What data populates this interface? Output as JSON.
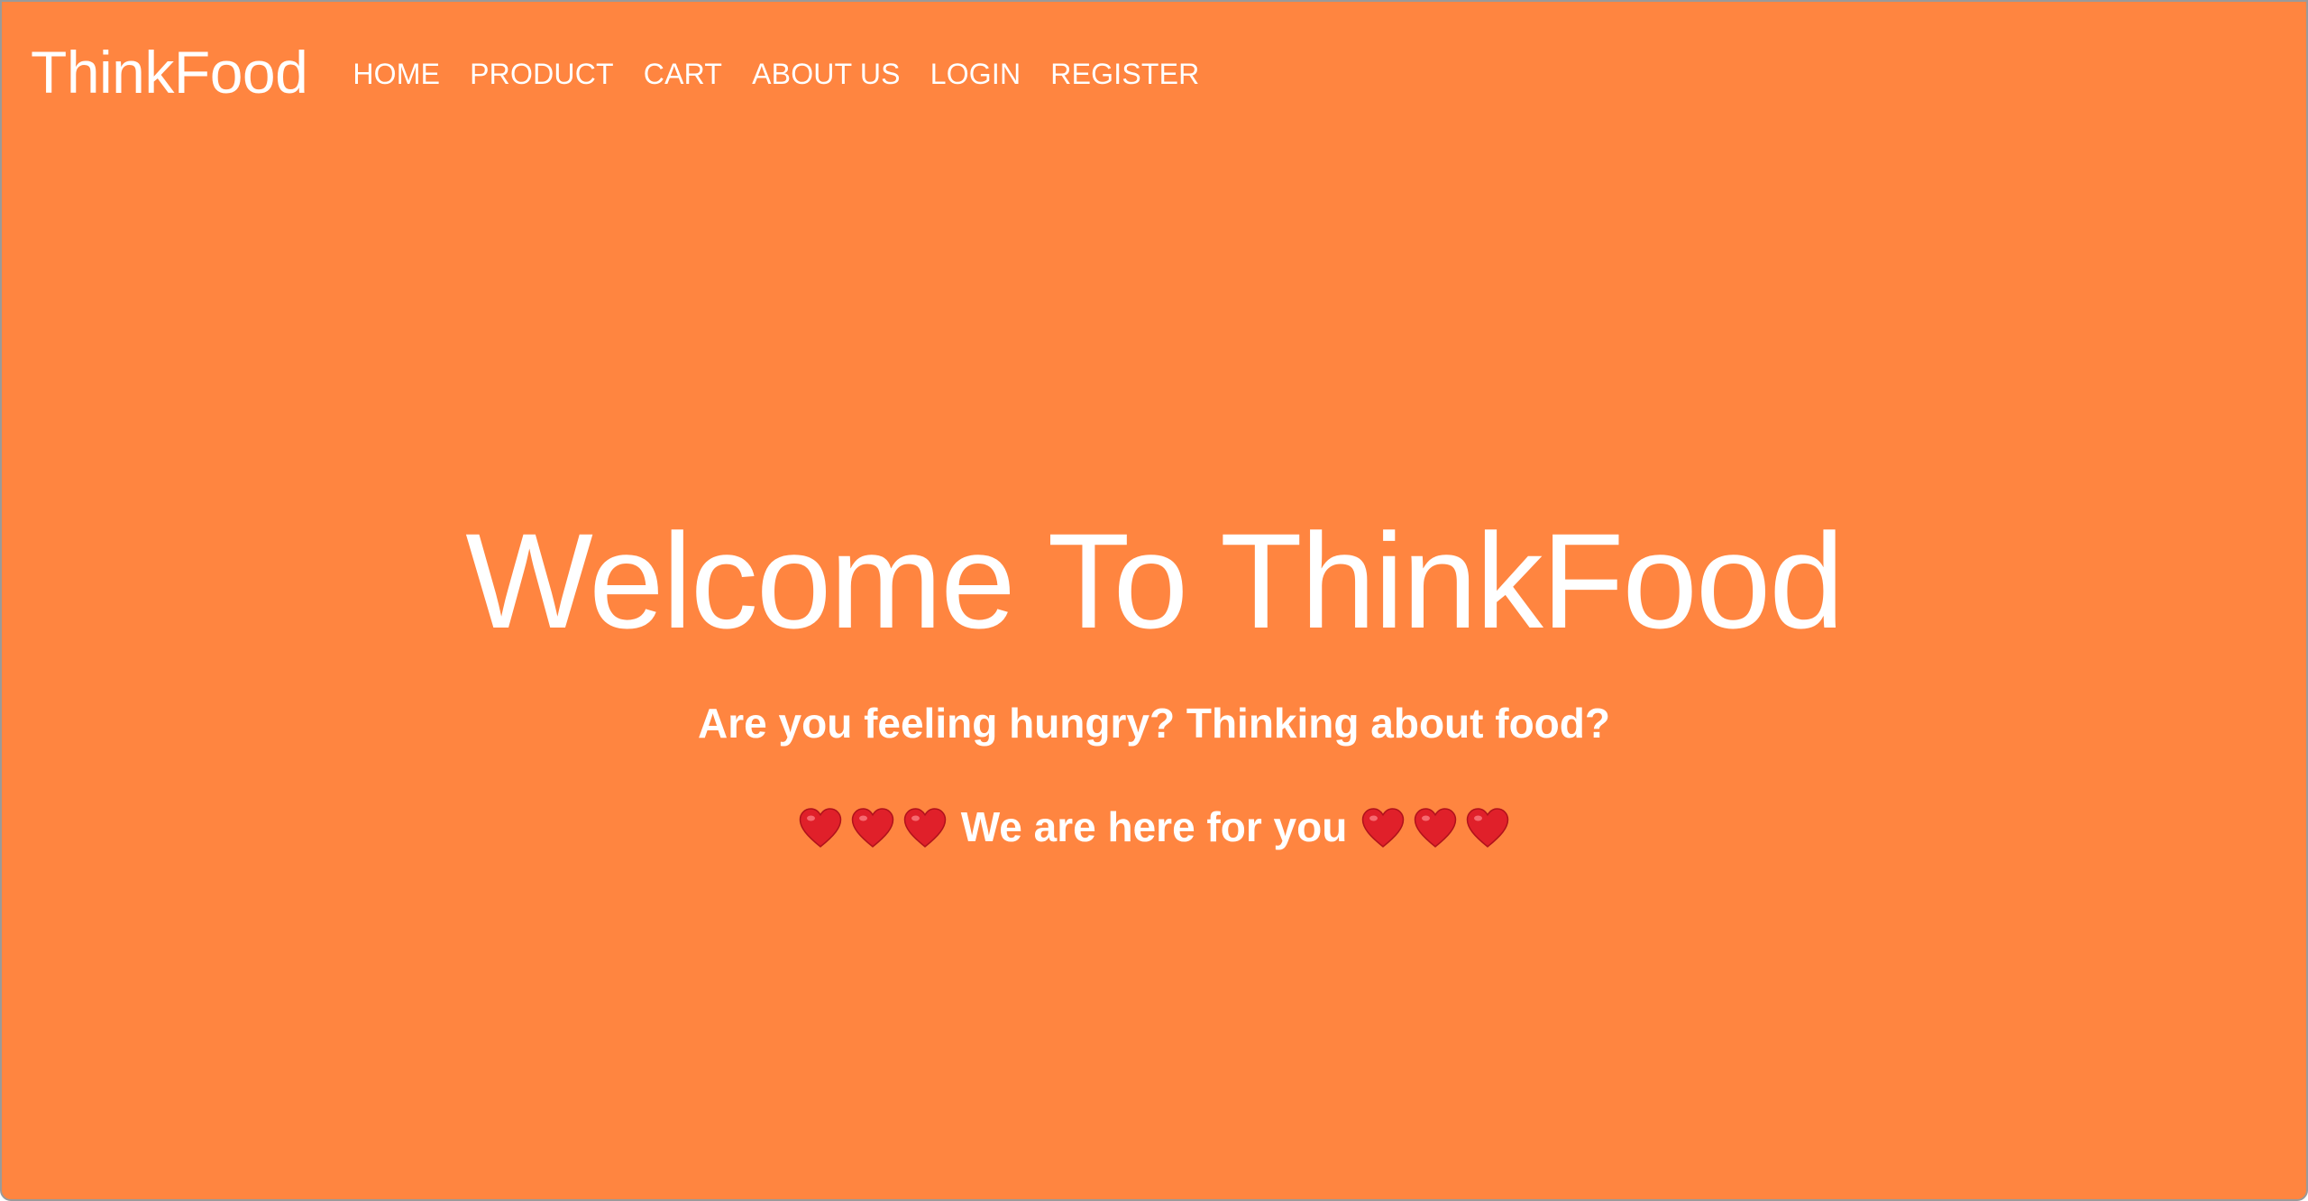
{
  "navbar": {
    "brand": "ThinkFood",
    "links": [
      "HOME",
      "PRODUCT",
      "CART",
      "ABOUT US",
      "LOGIN",
      "REGISTER"
    ]
  },
  "hero": {
    "title": "Welcome To ThinkFood",
    "subtitle": "Are you feeling hungry? Thinking about food?",
    "tagline": "We are here for you",
    "heart_icon": "red-heart-icon"
  },
  "colors": {
    "background": "#FF8540",
    "text": "#FFFFFF",
    "heart": "#E0202A"
  }
}
